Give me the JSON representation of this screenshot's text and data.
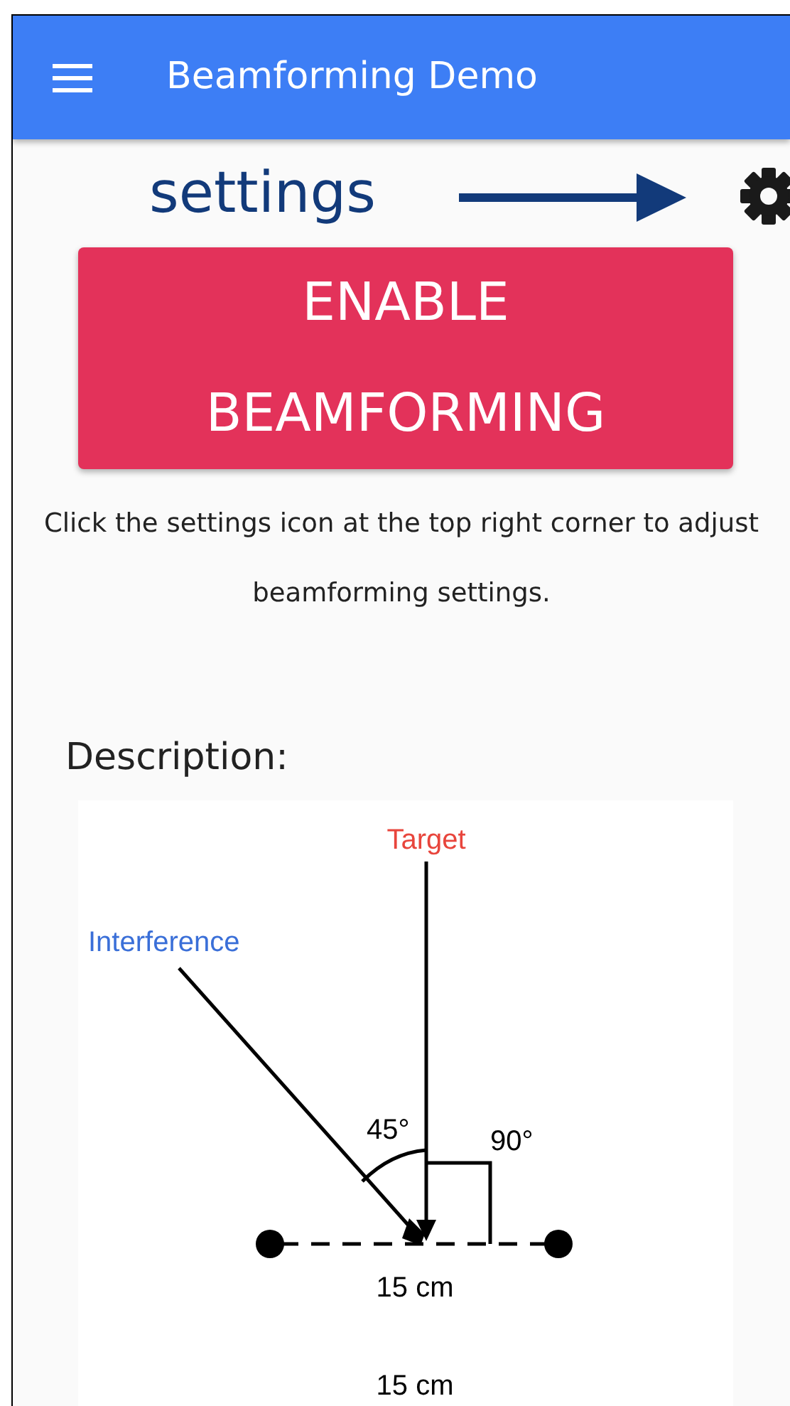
{
  "app_bar": {
    "title": "Beamforming Demo"
  },
  "hint": {
    "label": "settings"
  },
  "enable_button": {
    "label_lines": [
      "ENABLE",
      "BEAMFORMING"
    ]
  },
  "instructions": "Click the settings icon at the top right corner to adjust beamforming settings.",
  "description_heading": "Description:",
  "diagram": {
    "target_label": "Target",
    "interference_label": "Interference",
    "angle_label_1": "45°",
    "angle_label_2": "90°",
    "spacing_label": "15 cm",
    "bottom_label": "15 cm"
  }
}
